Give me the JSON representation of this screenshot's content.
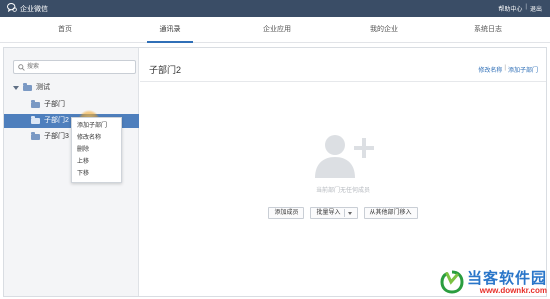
{
  "topbar": {
    "brand": "企业微信",
    "links": {
      "help": "帮助中心",
      "separator": "|",
      "logout": "退出"
    },
    "colors": {
      "background": "#3a4d66"
    }
  },
  "nav": {
    "tabs": [
      {
        "label": "首页",
        "active": false
      },
      {
        "label": "通讯录",
        "active": true
      },
      {
        "label": "企业应用",
        "active": false
      },
      {
        "label": "我的企业",
        "active": false
      },
      {
        "label": "系统日志",
        "active": false
      }
    ],
    "accent_color": "#2f6fb7"
  },
  "sidebar": {
    "search_placeholder": "搜索",
    "tree": {
      "root": {
        "label": "测试",
        "expanded": true
      },
      "children": [
        {
          "label": "子部门",
          "selected": false
        },
        {
          "label": "子部门2",
          "selected": true
        },
        {
          "label": "子部门3",
          "selected": false
        }
      ]
    },
    "selected_color": "#4e7fbd"
  },
  "context_menu": {
    "items": [
      "添加子部门",
      "修改名称",
      "删除",
      "上移",
      "下移"
    ]
  },
  "main": {
    "title": "子部门2",
    "actions": {
      "rename": "修改名称",
      "separator": "|",
      "add_sub": "添加子部门"
    },
    "empty_text": "当前部门无任何成员",
    "buttons": {
      "add_member": "添加成员",
      "batch_import": "批量导入",
      "move_from_other": "从其他部门移入"
    }
  },
  "watermark": {
    "cn": "当客软件园",
    "en": "www.downkr.com"
  }
}
